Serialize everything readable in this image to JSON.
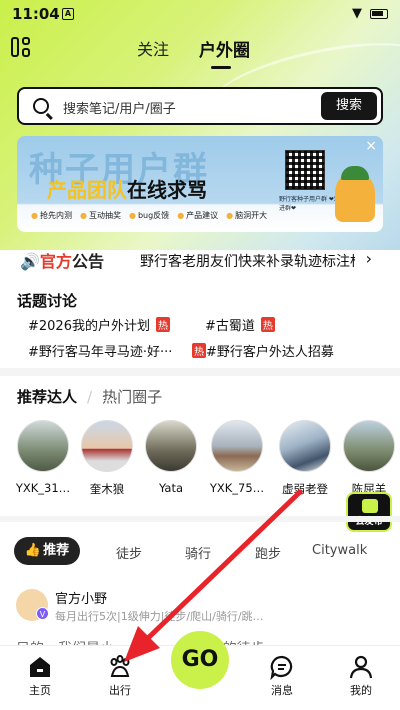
{
  "status_bar": {
    "time": "11:04",
    "notif_glyph": "A"
  },
  "top_nav": {
    "tabs": [
      "关注",
      "户外圈"
    ],
    "active_tab": "户外圈"
  },
  "search": {
    "placeholder": "搜索笔记/用户/圈子",
    "button": "搜索"
  },
  "banner": {
    "title": "种子用户群",
    "subtitle_yellow": "产品团队",
    "subtitle_black": "在线求骂",
    "qr_caption": "野行客种子用户群 ❤欢迎进群❤",
    "features": [
      "抢先内测",
      "互动抽奖",
      "bug反馈",
      "产品建议",
      "脑洞开大"
    ],
    "close": "×"
  },
  "notice": {
    "label_a": "官方",
    "label_b": "公告",
    "text": "野行客老朋友们快来补录轨迹标注标",
    "arrow": "›"
  },
  "topics": {
    "title": "话题讨论",
    "items": [
      {
        "text": "#2026我的户外计划",
        "hot": "热"
      },
      {
        "text": "#古蜀道",
        "hot": "热"
      },
      {
        "text": "#野行客马年寻马迹·好···",
        "hot": ""
      },
      {
        "text": "#野行客户外达人招募",
        "hot": "热"
      }
    ]
  },
  "talent_section": {
    "tabs": [
      "推荐达人",
      "热门圈子"
    ],
    "active": "推荐达人",
    "users": [
      "YXK_31…",
      "奎木狼",
      "Yata",
      "YXK_75…",
      "虚弱老登",
      "陈屈羊"
    ]
  },
  "publish_button": "去发布",
  "feed_tabs": [
    "推荐",
    "徒步",
    "骑行",
    "跑步",
    "Citywalk"
  ],
  "feed_active": "推荐",
  "post": {
    "author": "官方小野",
    "badge": "V",
    "desc": "每月出行5次|1级伸力|徒步/爬山/骑行/跳…",
    "body_partial": "目的，我们是小 · · · · · · · 发中做的徒步app"
  },
  "bottom_nav": {
    "items": [
      "主页",
      "出行",
      "GO",
      "消息",
      "我的"
    ]
  },
  "colors": {
    "accent": "#caf04a",
    "hot_red": "#e53b2e",
    "annotation_arrow": "#e8242a"
  }
}
